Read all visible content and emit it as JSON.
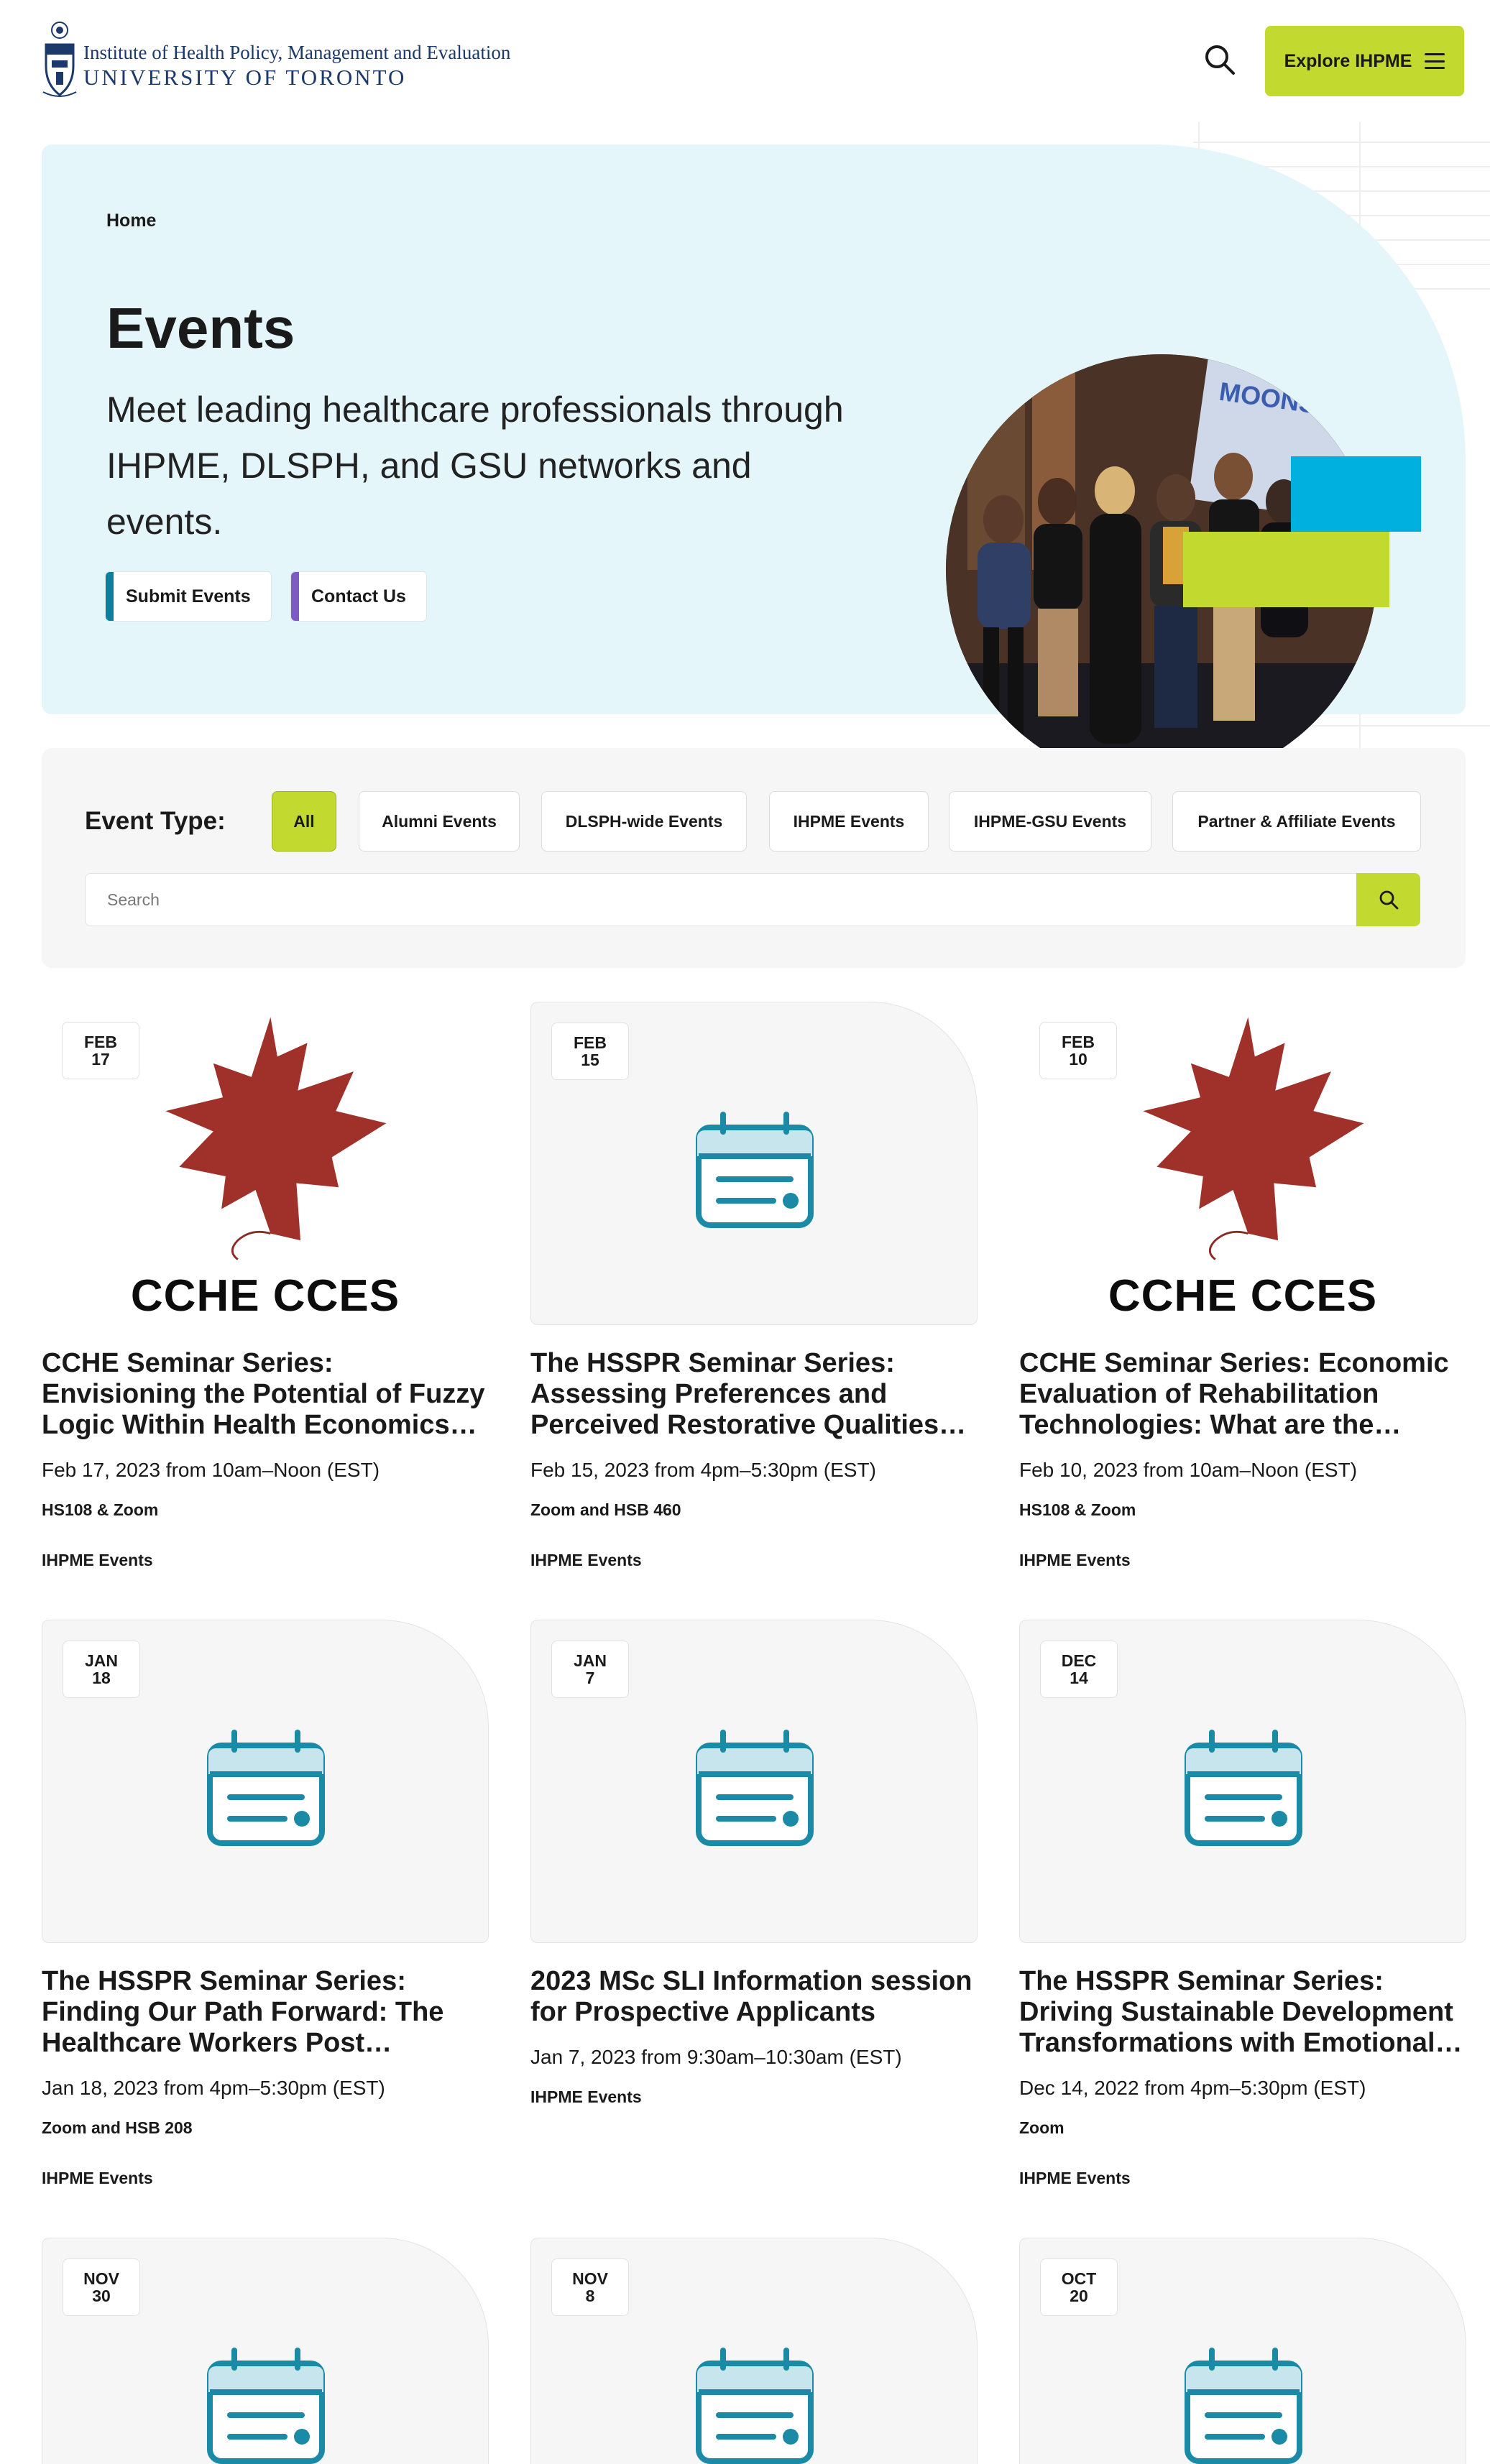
{
  "header": {
    "logo_line1": "Institute of Health Policy, Management and Evaluation",
    "logo_line2": "UNIVERSITY OF TORONTO",
    "explore_label": "Explore IHPME"
  },
  "hero": {
    "breadcrumb": "Home",
    "title": "Events",
    "description": "Meet leading healthcare professionals through IHPME, DLSPH, and GSU networks and events.",
    "submit_label": "Submit Events",
    "contact_label": "Contact Us",
    "photo_banner_text": "MOONSHOT"
  },
  "filter": {
    "label": "Event Type:",
    "chips": [
      "All",
      "Alumni Events",
      "DLSPH-wide Events",
      "IHPME Events",
      "IHPME-GSU Events",
      "Partner & Affiliate Events"
    ],
    "active": "All",
    "search_placeholder": "Search"
  },
  "cards": [
    {
      "month": "FEB",
      "day": "17",
      "logo_text": "CCHE  CCES",
      "title": "CCHE Seminar Series: Envisioning the Potential of Fuzzy Logic Within Health Economics and Beyond",
      "date": "Feb 17, 2023 from 10am–Noon (EST)",
      "location": "HS108 & Zoom",
      "type": "IHPME Events"
    },
    {
      "month": "FEB",
      "day": "15",
      "title": "The HSSPR Seminar Series: Assessing Preferences and Perceived Restorative Qualities of…",
      "date": "Feb 15, 2023 from 4pm–5:30pm (EST)",
      "location": "Zoom and HSB 460",
      "type": "IHPME Events"
    },
    {
      "month": "FEB",
      "day": "10",
      "logo_text": "CCHE  CCES",
      "title": "CCHE Seminar Series: Economic Evaluation of Rehabilitation Technologies: What are the Uniqu…",
      "date": "Feb 10, 2023 from 10am–Noon (EST)",
      "location": "HS108 & Zoom",
      "type": "IHPME Events"
    },
    {
      "month": "JAN",
      "day": "18",
      "title": "The HSSPR Seminar Series: Finding Our Path Forward: The Healthcare Workers Post Pandemic Journey…",
      "date": "Jan 18, 2023 from 4pm–5:30pm (EST)",
      "location": "Zoom and HSB 208",
      "type": "IHPME Events"
    },
    {
      "month": "JAN",
      "day": "7",
      "title": "2023 MSc SLI Information session for Prospective Applicants",
      "date": "Jan 7, 2023 from 9:30am–10:30am (EST)",
      "location": "",
      "type": "IHPME Events"
    },
    {
      "month": "DEC",
      "day": "14",
      "title": "The HSSPR Seminar Series: Driving Sustainable Development Transformations with Emotional…",
      "date": "Dec 14, 2022 from 4pm–5:30pm (EST)",
      "location": "Zoom",
      "type": "IHPME Events"
    },
    {
      "month": "NOV",
      "day": "30"
    },
    {
      "month": "NOV",
      "day": "8"
    },
    {
      "month": "OCT",
      "day": "20"
    }
  ],
  "colors": {
    "accent_green": "#c2d930",
    "accent_blue": "#00b1e0",
    "hero_bg": "#e4f6fa",
    "calendar_icon": "#1a8aa6",
    "submit_bar": "#0b7fa0",
    "contact_bar": "#7c5cc4",
    "leaf": "#a0302a"
  }
}
